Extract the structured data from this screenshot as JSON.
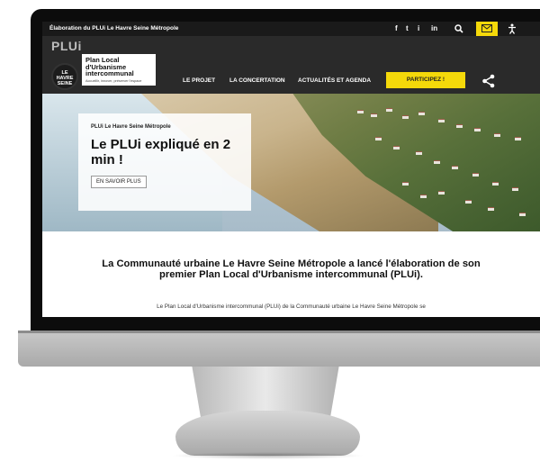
{
  "topbar": {
    "title": "Élaboration du PLUi Le Havre Seine Métropole",
    "social": [
      "f",
      "t",
      "i",
      "in"
    ]
  },
  "header": {
    "tag": "PLUi",
    "logo_circle": [
      "LE",
      "HAVRE",
      "SEINE"
    ],
    "logo_title": [
      "Plan Local",
      "d'Urbanisme",
      "intercommunal"
    ],
    "logo_tagline": "Accueillir, innover, préserver l'espace",
    "nav": [
      "LE PROJET",
      "LA CONCERTATION",
      "ACTUALITÉS ET AGENDA"
    ],
    "cta": "PARTICIPEZ !"
  },
  "hero": {
    "kicker": "PLUi Le Havre Seine Métropole",
    "headline": "Le PLUi expliqué en 2 min !",
    "button": "EN SAVOIR PLUS"
  },
  "intro": {
    "title": "La Communauté urbaine Le Havre Seine Métropole a lancé l'élaboration de son premier Plan Local d'Urbanisme intercommunal (PLUi).",
    "text": "Le Plan Local d'Urbanisme intercommunal (PLUi) de la Communauté urbaine Le Havre Seine Métropole se"
  },
  "colors": {
    "accent": "#f5d90a",
    "header_bg": "#2a2a2a",
    "topbar_bg": "#1a1a1a"
  },
  "icons": {
    "search": "search-icon",
    "mail": "mail-icon",
    "accessibility": "accessibility-icon",
    "share": "share-icon"
  }
}
